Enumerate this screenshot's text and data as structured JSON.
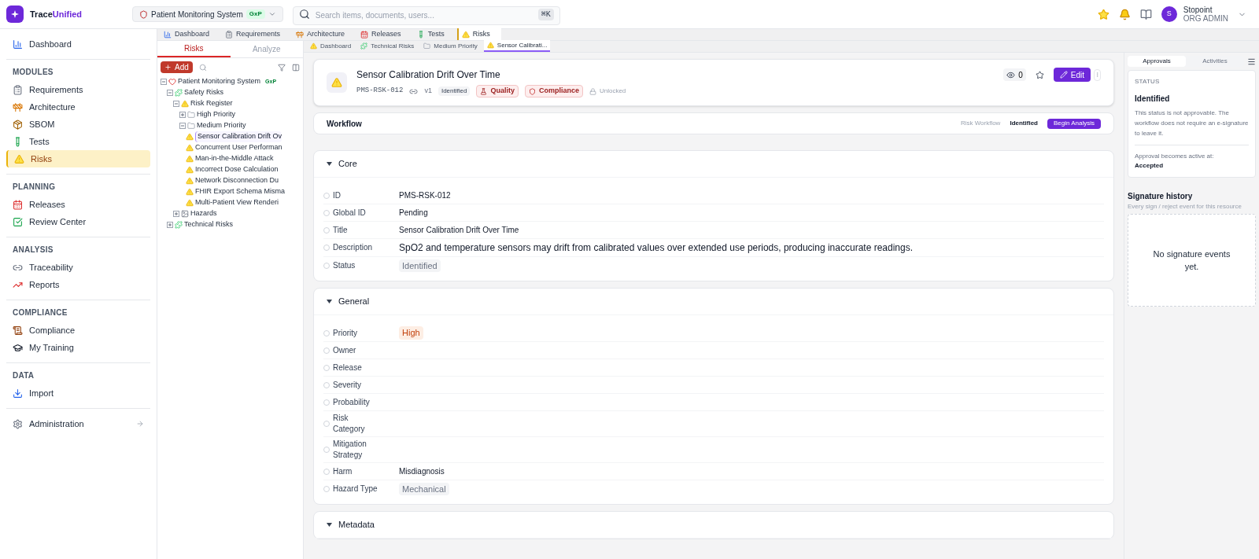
{
  "header": {
    "brand": {
      "prefix": "Trace",
      "suffix": "Unified"
    },
    "project": {
      "name": "Patient Monitoring System",
      "badge": "GxP"
    },
    "search": {
      "placeholder": "Search items, documents, users...",
      "shortcut": "⌘K"
    },
    "user": {
      "initial": "S",
      "name": "Stopoint",
      "role": "ORG ADMIN"
    }
  },
  "sidebar": {
    "sections": [
      {
        "items": [
          {
            "label": "Dashboard",
            "selected": false
          }
        ]
      },
      {
        "title": "MODULES",
        "items": [
          {
            "label": "Requirements",
            "selected": false
          },
          {
            "label": "Architecture",
            "selected": false
          },
          {
            "label": "SBOM",
            "selected": false
          },
          {
            "label": "Tests",
            "selected": false
          },
          {
            "label": "Risks",
            "selected": true
          }
        ]
      },
      {
        "title": "PLANNING",
        "items": [
          {
            "label": "Releases",
            "selected": false
          },
          {
            "label": "Review Center",
            "selected": false
          }
        ]
      },
      {
        "title": "ANALYSIS",
        "items": [
          {
            "label": "Traceability",
            "selected": false
          },
          {
            "label": "Reports",
            "selected": false
          }
        ]
      },
      {
        "title": "COMPLIANCE",
        "items": [
          {
            "label": "Compliance",
            "selected": false
          },
          {
            "label": "My Training",
            "selected": false
          }
        ]
      },
      {
        "title": "DATA",
        "items": [
          {
            "label": "Import",
            "selected": false
          }
        ]
      },
      {
        "items": [
          {
            "label": "Administration",
            "selected": false
          }
        ]
      }
    ]
  },
  "module_tabs": [
    {
      "label": "Dashboard",
      "selected": false
    },
    {
      "label": "Requirements",
      "selected": false
    },
    {
      "label": "Architecture",
      "selected": false
    },
    {
      "label": "Releases",
      "selected": false
    },
    {
      "label": "Tests",
      "selected": false
    },
    {
      "label": "Risks",
      "selected": true
    }
  ],
  "sub_tabs": [
    {
      "label": "Dashboard",
      "selected": false
    },
    {
      "label": "Technical Risks",
      "selected": false
    },
    {
      "label": "Medium Priority",
      "selected": false
    },
    {
      "label": "Sensor Calibrati...",
      "selected": true
    }
  ],
  "tree_panel": {
    "tabs": [
      {
        "label": "Risks",
        "selected": true
      },
      {
        "label": "Analyze",
        "selected": false
      }
    ],
    "add_label": "Add",
    "tree": [
      {
        "label": "Patient Monitoring System",
        "kind": "project",
        "badge": "GxP",
        "expanded": true,
        "selected": false,
        "children": [
          {
            "label": "Safety Risks",
            "kind": "group",
            "expanded": true,
            "selected": false,
            "children": [
              {
                "label": "Risk Register",
                "kind": "risk",
                "expanded": true,
                "selected": false,
                "children": [
                  {
                    "label": "High Priority",
                    "kind": "folder",
                    "expanded": false,
                    "selected": false
                  },
                  {
                    "label": "Medium Priority",
                    "kind": "folder",
                    "expanded": true,
                    "selected": false,
                    "children": [
                      {
                        "label": "Sensor Calibration Drift Ov",
                        "kind": "risk",
                        "selected": true
                      },
                      {
                        "label": "Concurrent User Performan",
                        "kind": "risk",
                        "selected": false
                      },
                      {
                        "label": "Man-in-the-Middle Attack",
                        "kind": "risk",
                        "selected": false
                      },
                      {
                        "label": "Incorrect Dose Calculation",
                        "kind": "risk",
                        "selected": false
                      },
                      {
                        "label": "Network Disconnection Du",
                        "kind": "risk",
                        "selected": false
                      },
                      {
                        "label": "FHIR Export Schema Misma",
                        "kind": "risk",
                        "selected": false
                      },
                      {
                        "label": "Multi-Patient View Renderi",
                        "kind": "risk",
                        "selected": false
                      }
                    ]
                  }
                ]
              },
              {
                "label": "Hazards",
                "kind": "hazard",
                "expanded": false,
                "selected": false
              }
            ]
          },
          {
            "label": "Technical Risks",
            "kind": "group",
            "expanded": false,
            "selected": false
          }
        ]
      }
    ]
  },
  "detail": {
    "title": "Sensor Calibration Drift Over Time",
    "id": "PMS-RSK-012",
    "version": "v1",
    "status": "Identified",
    "tags": [
      "Quality",
      "Compliance"
    ],
    "lock": "Unlocked",
    "views": "0",
    "edit_label": "Edit"
  },
  "workflow": {
    "title": "Workflow",
    "name": "Risk Workflow",
    "state": "Identified",
    "action": "Begin Analysis"
  },
  "sections": [
    {
      "title": "Core",
      "expanded": true,
      "fields": [
        {
          "label": "ID",
          "value": "PMS-RSK-012",
          "kind": "text"
        },
        {
          "label": "Global ID",
          "value": "Pending",
          "kind": "text"
        },
        {
          "label": "Title",
          "value": "Sensor Calibration Drift Over Time",
          "kind": "text"
        },
        {
          "label": "Description",
          "value": "SpO2 and temperature sensors may drift from calibrated values over extended use periods, producing inaccurate readings.",
          "kind": "large"
        },
        {
          "label": "Status",
          "value": "Identified",
          "kind": "tag"
        }
      ]
    },
    {
      "title": "General",
      "expanded": true,
      "fields": [
        {
          "label": "Priority",
          "value": "High",
          "kind": "priority"
        },
        {
          "label": "Owner",
          "kind": "empty"
        },
        {
          "label": "Release",
          "kind": "empty"
        },
        {
          "label": "Severity",
          "kind": "empty"
        },
        {
          "label": "Probability",
          "kind": "empty"
        },
        {
          "label": "Risk Category",
          "kind": "empty"
        },
        {
          "label": "Mitigation Strategy",
          "kind": "empty"
        },
        {
          "label": "Harm",
          "value": "Misdiagnosis",
          "kind": "text"
        },
        {
          "label": "Hazard Type",
          "value": "Mechanical",
          "kind": "tag"
        }
      ]
    },
    {
      "title": "Metadata",
      "expanded": true
    }
  ],
  "right_panel": {
    "tabs": [
      {
        "label": "Approvals",
        "selected": true
      },
      {
        "label": "Activities",
        "selected": false
      }
    ],
    "status": {
      "heading": "STATUS",
      "state": "Identified",
      "note": "This status is not approvable. The workflow does not require an e-signature to leave it.",
      "active_label": "Approval becomes active at:",
      "active_state": "Accepted"
    },
    "signatures": {
      "title": "Signature history",
      "subtitle": "Every sign / reject event for this resource",
      "empty": "No signature events yet."
    }
  }
}
